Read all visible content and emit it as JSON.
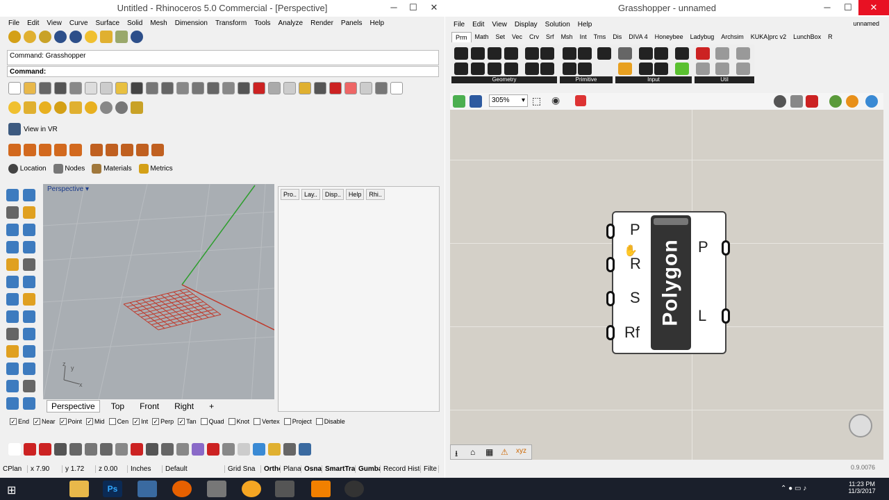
{
  "rhino": {
    "title": "Untitled - Rhinoceros 5.0 Commercial - [Perspective]",
    "menu": [
      "File",
      "Edit",
      "View",
      "Curve",
      "Surface",
      "Solid",
      "Mesh",
      "Dimension",
      "Transform",
      "Tools",
      "Analyze",
      "Render",
      "Panels",
      "Help"
    ],
    "command_history": "Command: Grasshopper",
    "command_prompt": "Command:",
    "view_in_vr": "View in VR",
    "named_tabs": [
      "Location",
      "Nodes",
      "Materials",
      "Metrics"
    ],
    "viewport_label": "Perspective",
    "viewport_tabs": [
      "Perspective",
      "Top",
      "Front",
      "Right"
    ],
    "panel_tabs": [
      "Pro..",
      "Lay..",
      "Disp..",
      "Help",
      "Rhi.."
    ],
    "osnaps": [
      {
        "label": "End",
        "checked": true
      },
      {
        "label": "Near",
        "checked": true
      },
      {
        "label": "Point",
        "checked": true
      },
      {
        "label": "Mid",
        "checked": true
      },
      {
        "label": "Cen",
        "checked": false
      },
      {
        "label": "Int",
        "checked": true
      },
      {
        "label": "Perp",
        "checked": true
      },
      {
        "label": "Tan",
        "checked": true
      },
      {
        "label": "Quad",
        "checked": false
      },
      {
        "label": "Knot",
        "checked": false
      },
      {
        "label": "Vertex",
        "checked": false
      },
      {
        "label": "Project",
        "checked": false
      },
      {
        "label": "Disable",
        "checked": false
      }
    ],
    "status": [
      "CPlan",
      "x 7.90",
      "y 1.72",
      "z 0.00",
      "Inches",
      "Default",
      "Grid Sna",
      "Ortho",
      "Plana",
      "Osnap",
      "SmartTra",
      "Gumba",
      "Record Histo",
      "Filte"
    ]
  },
  "grasshopper": {
    "title": "Grasshopper - unnamed",
    "doc_name": "unnamed",
    "menu": [
      "File",
      "Edit",
      "View",
      "Display",
      "Solution",
      "Help"
    ],
    "tabs": [
      "Prm",
      "Math",
      "Set",
      "Vec",
      "Crv",
      "Srf",
      "Msh",
      "Int",
      "Trns",
      "Dis",
      "DIVA 4",
      "Honeybee",
      "Ladybug",
      "Archsim",
      "KUKA|prc v2",
      "LunchBox",
      "R"
    ],
    "active_tab": "Prm",
    "groups": [
      "Geometry",
      "Primitive",
      "Input",
      "Util"
    ],
    "zoom": "305%",
    "component": {
      "name": "Polygon",
      "inputs": [
        "P",
        "R",
        "S",
        "Rf"
      ],
      "outputs": [
        "P",
        "L"
      ]
    },
    "version": "0.9.0076"
  },
  "taskbar": {
    "time": "11:23 PM",
    "date": "11/3/2017"
  },
  "colors": {
    "rhino_grid_red": "#c0392b",
    "axis_green": "#2e9e2e",
    "canvas_bg": "#d4d0c8",
    "taskbar": "#1a1f2b"
  }
}
